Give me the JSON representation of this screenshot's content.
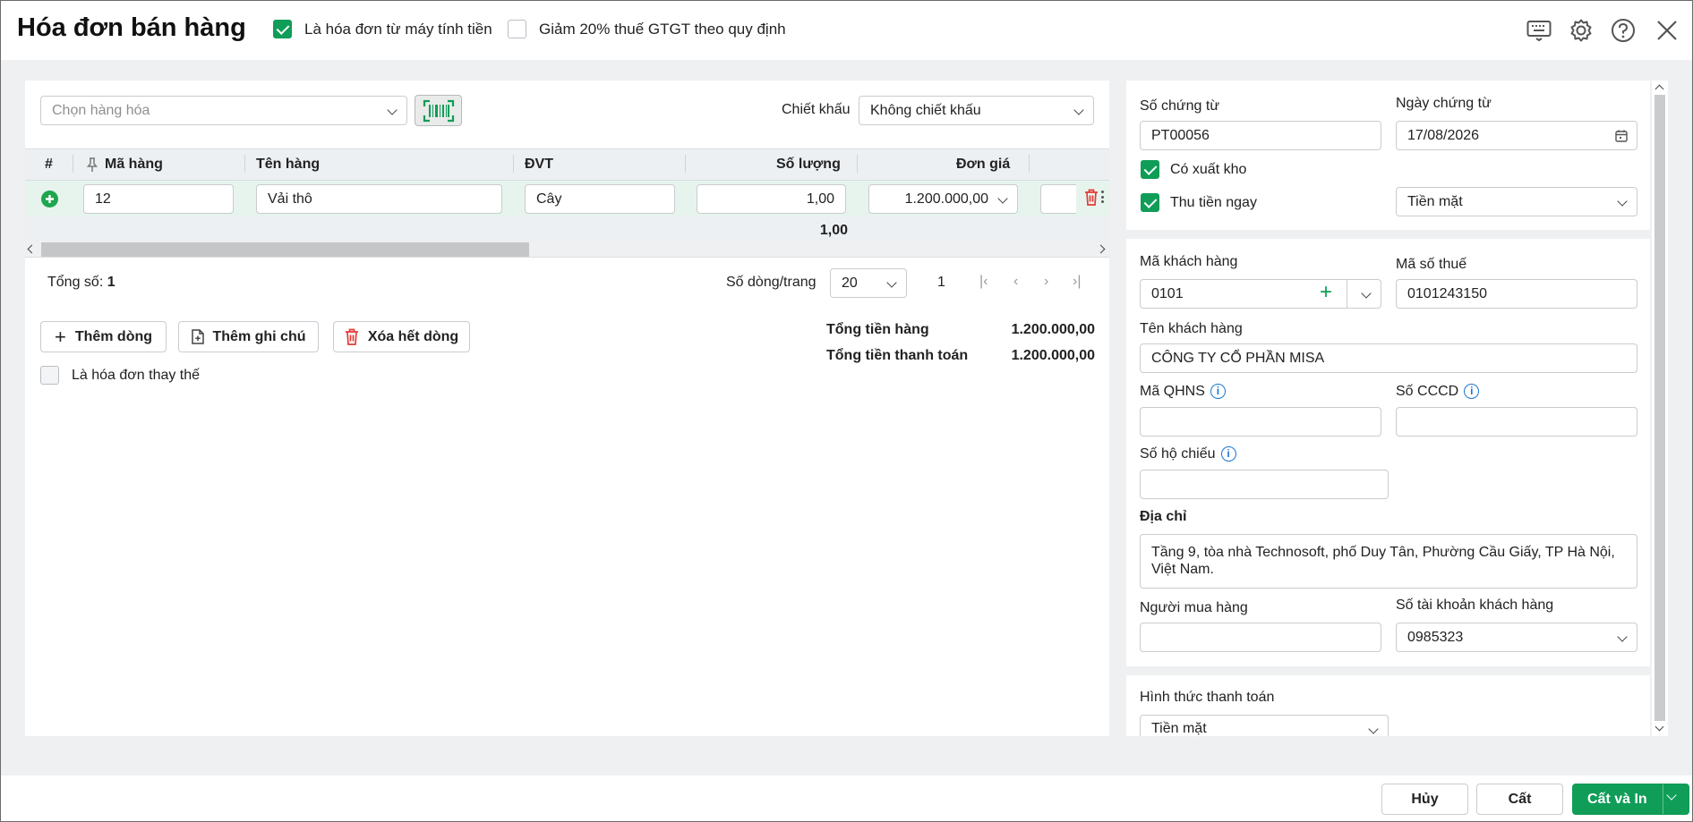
{
  "header": {
    "title": "Hóa đơn bán hàng",
    "opt_cash_register": "Là hóa đơn từ máy tính tiền",
    "opt_vat_reduction": "Giảm 20% thuế GTGT theo quy định"
  },
  "toolbar": {
    "item_placeholder": "Chọn hàng hóa",
    "discount_label": "Chiết khấu",
    "discount_value": "Không chiết khấu"
  },
  "grid": {
    "columns": [
      "#",
      "Mã hàng",
      "Tên hàng",
      "ĐVT",
      "Số lượng",
      "Đơn giá"
    ],
    "rows": [
      {
        "code": "12",
        "name": "Vải thô",
        "unit": "Cây",
        "qty": "1,00",
        "price": "1.200.000,00"
      }
    ],
    "total_qty": "1,00"
  },
  "pager": {
    "total_label": "Tổng số:",
    "total_value": "1",
    "per_page_label": "Số dòng/trang",
    "per_page_value": "20",
    "page": "1"
  },
  "actions": {
    "add_row": "Thêm dòng",
    "add_note": "Thêm ghi chú",
    "delete_all": "Xóa hết dòng",
    "replacement_invoice": "Là hóa đơn thay thế"
  },
  "totals": {
    "goods_label": "Tổng tiền hàng",
    "goods_value": "1.200.000,00",
    "pay_label": "Tổng tiền thanh toán",
    "pay_value": "1.200.000,00"
  },
  "voucher": {
    "no_label": "Số chứng từ",
    "no_value": "PT00056",
    "date_label": "Ngày chứng từ",
    "date_value": "17/08/2026",
    "stock_out": "Có xuất kho",
    "collect_now": "Thu tiền ngay",
    "collect_method": "Tiền mặt"
  },
  "customer": {
    "code_label": "Mã khách hàng",
    "code_value": "0101",
    "tax_label": "Mã số thuế",
    "tax_value": "0101243150",
    "name_label": "Tên khách hàng",
    "name_value": "CÔNG TY CỔ PHẦN MISA",
    "qhns_label": "Mã QHNS",
    "cccd_label": "Số CCCD",
    "passport_label": "Số hộ chiếu",
    "address_label": "Địa chỉ",
    "address_value": "Tầng 9, tòa nhà Technosoft, phố Duy Tân, Phường Cầu Giấy, TP Hà Nội, Việt Nam.",
    "buyer_label": "Người mua hàng",
    "account_label": "Số tài khoản khách hàng",
    "account_value": "0985323"
  },
  "payment": {
    "method_label": "Hình thức thanh toán",
    "method_value": "Tiền mặt"
  },
  "footer": {
    "cancel": "Hủy",
    "save": "Cất",
    "save_print": "Cất và In"
  },
  "colors": {
    "accent": "#0f9d58",
    "danger": "#e53935",
    "link": "#1976d2"
  }
}
